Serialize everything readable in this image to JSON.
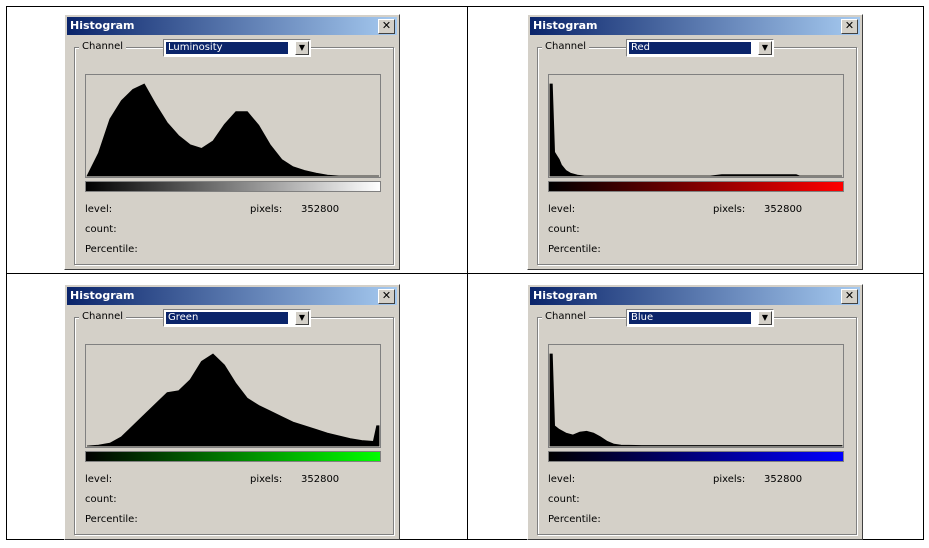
{
  "windows": [
    {
      "title": "Histogram",
      "channel_label": "Channel",
      "channel_value": "Luminosity",
      "level_label": "level:",
      "count_label": "count:",
      "percentile_label": "Percentile:",
      "pixels_label": "pixels:",
      "pixels_value": "352800",
      "gradient_colors": [
        "#000000",
        "#ffffff"
      ]
    },
    {
      "title": "Histogram",
      "channel_label": "Channel",
      "channel_value": "Red",
      "level_label": "level:",
      "count_label": "count:",
      "percentile_label": "Percentile:",
      "pixels_label": "pixels:",
      "pixels_value": "352800",
      "gradient_colors": [
        "#000000",
        "#ff0000"
      ]
    },
    {
      "title": "Histogram",
      "channel_label": "Channel",
      "channel_value": "Green",
      "level_label": "level:",
      "count_label": "count:",
      "percentile_label": "Percentile:",
      "pixels_label": "pixels:",
      "pixels_value": "352800",
      "gradient_colors": [
        "#000000",
        "#00ff00"
      ]
    },
    {
      "title": "Histogram",
      "channel_label": "Channel",
      "channel_value": "Blue",
      "level_label": "level:",
      "count_label": "count:",
      "percentile_label": "Percentile:",
      "pixels_label": "pixels:",
      "pixels_value": "352800",
      "gradient_colors": [
        "#000000",
        "#0000ff"
      ]
    }
  ],
  "chart_data": [
    {
      "type": "area",
      "channel": "Luminosity",
      "xlim": [
        0,
        255
      ],
      "ylim": [
        0,
        100
      ],
      "x": [
        0,
        10,
        20,
        30,
        40,
        50,
        60,
        70,
        80,
        90,
        100,
        110,
        120,
        130,
        140,
        150,
        160,
        170,
        180,
        190,
        200,
        210,
        220,
        230,
        240,
        255
      ],
      "values": [
        0,
        25,
        62,
        82,
        94,
        100,
        78,
        58,
        44,
        34,
        30,
        38,
        56,
        70,
        70,
        55,
        34,
        18,
        10,
        6,
        3,
        1,
        0,
        0,
        0,
        0
      ]
    },
    {
      "type": "area",
      "channel": "Red",
      "xlim": [
        0,
        255
      ],
      "ylim": [
        0,
        100
      ],
      "x": [
        0,
        2,
        4,
        6,
        8,
        10,
        14,
        18,
        24,
        30,
        140,
        150,
        160,
        170,
        180,
        190,
        215,
        218,
        255
      ],
      "values": [
        100,
        100,
        26,
        22,
        18,
        12,
        6,
        3,
        1,
        0,
        0,
        1.5,
        1.5,
        1.5,
        1.5,
        1.5,
        1.5,
        0,
        0
      ]
    },
    {
      "type": "area",
      "channel": "Green",
      "xlim": [
        0,
        255
      ],
      "ylim": [
        0,
        100
      ],
      "x": [
        0,
        10,
        20,
        30,
        40,
        50,
        60,
        70,
        80,
        90,
        100,
        110,
        120,
        130,
        140,
        150,
        160,
        170,
        180,
        190,
        200,
        210,
        220,
        230,
        240,
        250,
        253,
        255
      ],
      "values": [
        0,
        1,
        3,
        10,
        22,
        34,
        46,
        58,
        60,
        72,
        92,
        100,
        88,
        68,
        52,
        44,
        38,
        32,
        26,
        22,
        18,
        14,
        11,
        8,
        6,
        5,
        22,
        22
      ]
    },
    {
      "type": "area",
      "channel": "Blue",
      "xlim": [
        0,
        255
      ],
      "ylim": [
        0,
        100
      ],
      "x": [
        0,
        2,
        4,
        8,
        14,
        20,
        26,
        32,
        38,
        44,
        50,
        56,
        62,
        80,
        120,
        160,
        200,
        255
      ],
      "values": [
        100,
        100,
        22,
        18,
        14,
        12,
        15,
        16,
        14,
        10,
        5,
        2,
        1,
        0.5,
        0.5,
        0.5,
        0.5,
        0.5
      ]
    }
  ]
}
